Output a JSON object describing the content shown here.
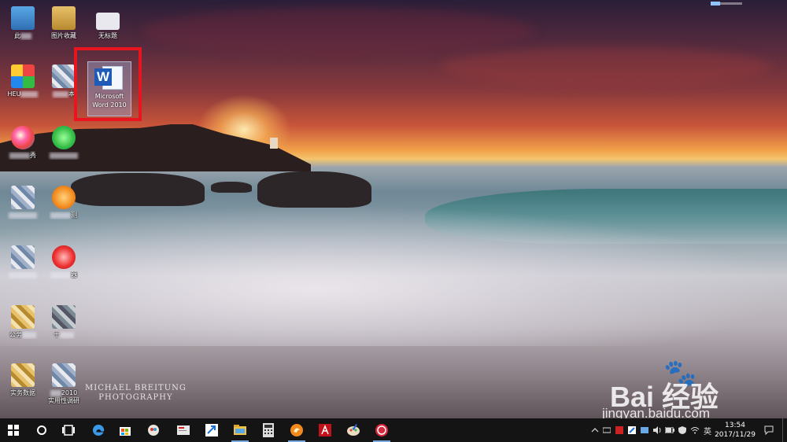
{
  "desktop": {
    "icons": [
      {
        "id": "this-pc",
        "label": "此"
      },
      {
        "id": "picture-collection",
        "label": "图片收藏"
      },
      {
        "id": "untitled",
        "label": "无标题"
      },
      {
        "id": "heu",
        "label": "HEU"
      },
      {
        "id": "text-doc",
        "label": "本"
      },
      {
        "id": "word",
        "label": "Microsoft Word 2010"
      },
      {
        "id": "app-ball",
        "label": "秀"
      },
      {
        "id": "app-green",
        "label": ""
      },
      {
        "id": "app-file",
        "label": ""
      },
      {
        "id": "app-orange",
        "label": "测"
      },
      {
        "id": "app-doc2",
        "label": ""
      },
      {
        "id": "app-red",
        "label": "器"
      },
      {
        "id": "folder-gong",
        "label": "公务"
      },
      {
        "id": "app-ten",
        "label": "十"
      },
      {
        "id": "folder-shi",
        "label": "实务数据"
      },
      {
        "id": "app-2010",
        "label": "2010"
      },
      {
        "id": "app-2010-sub",
        "label": "实用性调研"
      }
    ],
    "watermark": {
      "credit_line1": "MICHAEL BREITUNG",
      "credit_line2": "PHOTOGRAPHY",
      "brand": "Bai  经验",
      "paw": "🐾",
      "url": "jingyan.baidu.com"
    }
  },
  "taskbar": {
    "clock_time": "13:54",
    "clock_date": "2017/11/29",
    "ime": "英",
    "colors": {
      "accent": "#7aa9e0",
      "background": "#141414",
      "highlight": "#e8141e"
    },
    "pinned": [
      {
        "name": "start-icon"
      },
      {
        "name": "cortana-icon"
      },
      {
        "name": "task-view-icon"
      },
      {
        "name": "edge-icon"
      },
      {
        "name": "store-icon"
      },
      {
        "name": "app-people-icon"
      },
      {
        "name": "app-card-icon"
      },
      {
        "name": "app-arrow-icon"
      },
      {
        "name": "file-explorer-icon"
      },
      {
        "name": "calculator-icon"
      },
      {
        "name": "app-fire-icon"
      },
      {
        "name": "acrobat-icon"
      },
      {
        "name": "paint-icon"
      },
      {
        "name": "app-red-circle-icon"
      }
    ]
  }
}
